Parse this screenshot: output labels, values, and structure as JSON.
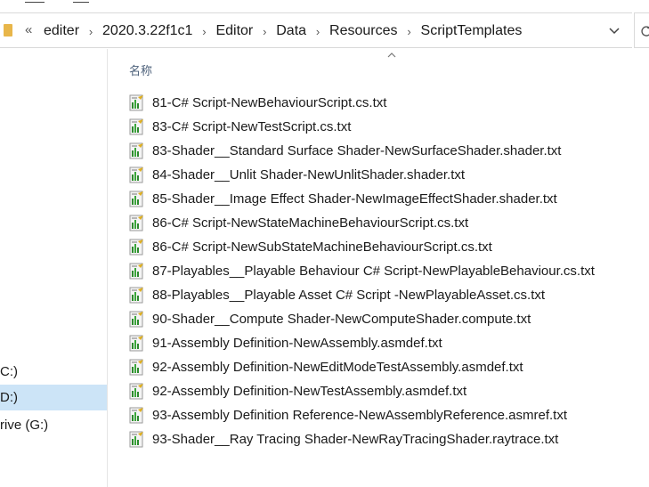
{
  "breadcrumb": {
    "overflow": "«",
    "items": [
      "editer",
      "2020.3.22f1c1",
      "Editor",
      "Data",
      "Resources",
      "ScriptTemplates"
    ],
    "separator": "›"
  },
  "nav": {
    "items": [
      {
        "label": "C:)",
        "selected": false
      },
      {
        "label": "D:)",
        "selected": true
      },
      {
        "label": "rive (G:)",
        "selected": false
      }
    ]
  },
  "list": {
    "column_header": "名称",
    "files": [
      "81-C# Script-NewBehaviourScript.cs.txt",
      "83-C# Script-NewTestScript.cs.txt",
      "83-Shader__Standard Surface Shader-NewSurfaceShader.shader.txt",
      "84-Shader__Unlit Shader-NewUnlitShader.shader.txt",
      "85-Shader__Image Effect Shader-NewImageEffectShader.shader.txt",
      "86-C# Script-NewStateMachineBehaviourScript.cs.txt",
      "86-C# Script-NewSubStateMachineBehaviourScript.cs.txt",
      "87-Playables__Playable Behaviour C# Script-NewPlayableBehaviour.cs.txt",
      "88-Playables__Playable Asset C# Script -NewPlayableAsset.cs.txt",
      "90-Shader__Compute Shader-NewComputeShader.compute.txt",
      "91-Assembly Definition-NewAssembly.asmdef.txt",
      "92-Assembly Definition-NewEditModeTestAssembly.asmdef.txt",
      "92-Assembly Definition-NewTestAssembly.asmdef.txt",
      "93-Assembly Definition Reference-NewAssemblyReference.asmref.txt",
      "93-Shader__Ray Tracing Shader-NewRayTracingShader.raytrace.txt"
    ]
  },
  "icons": {
    "folder": "folder-icon",
    "file": "text-file-icon",
    "dropdown": "chevron-down-icon",
    "refresh": "refresh-icon",
    "sort": "sort-ascending-icon"
  },
  "colors": {
    "selection": "#cce4f7",
    "header_text": "#4c607a",
    "folder": "#e8b64a"
  }
}
